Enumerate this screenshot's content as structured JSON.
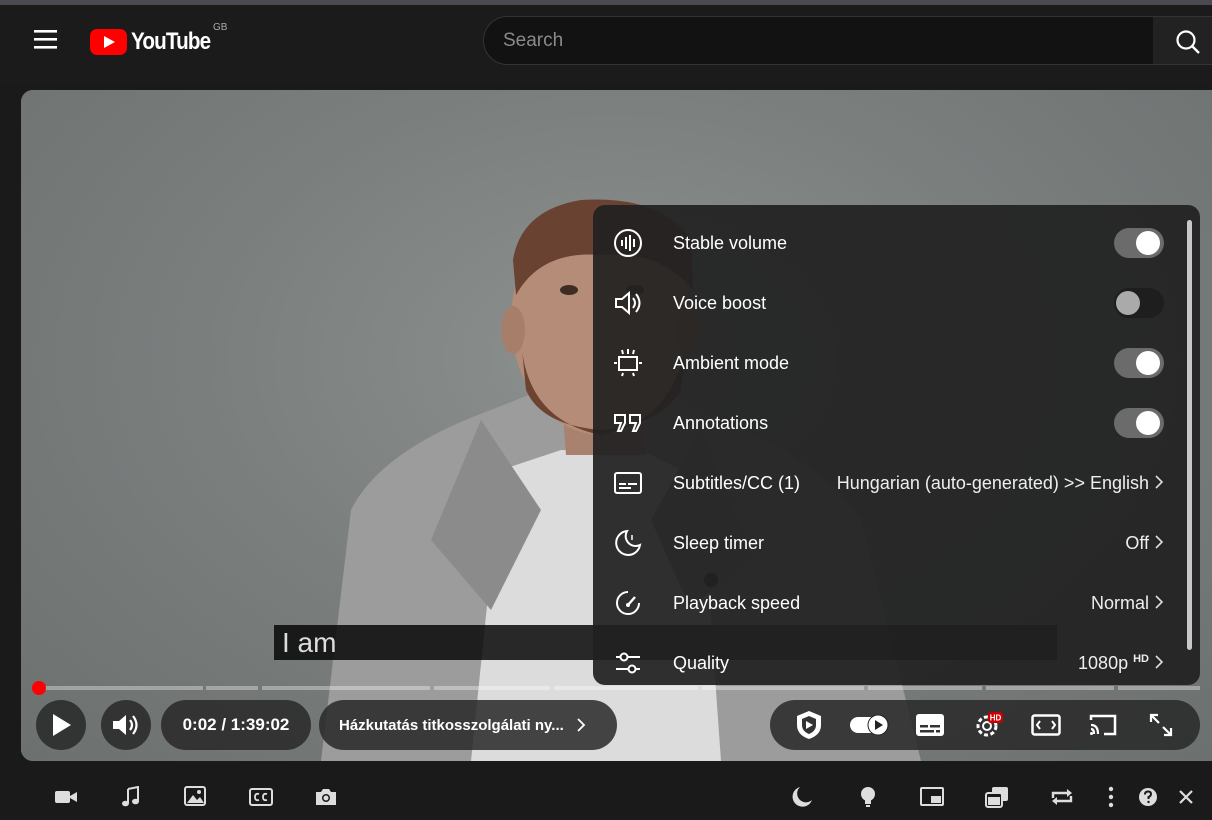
{
  "masthead": {
    "logo_text": "YouTube",
    "country_code": "GB",
    "search_placeholder": "Search"
  },
  "video": {
    "caption_text": "I am",
    "time_display": "0:02 / 1:39:02",
    "chapter_title": "Házkutatás titkosszolgálati ny...",
    "progress_fraction": 0.0003
  },
  "settings": {
    "items": [
      {
        "label": "Stable volume",
        "type": "toggle",
        "state": "on",
        "icon": "stable-volume-icon"
      },
      {
        "label": "Voice boost",
        "type": "toggle",
        "state": "off",
        "icon": "voice-boost-icon"
      },
      {
        "label": "Ambient mode",
        "type": "toggle",
        "state": "on",
        "icon": "ambient-mode-icon"
      },
      {
        "label": "Annotations",
        "type": "toggle",
        "state": "on",
        "icon": "annotations-icon"
      },
      {
        "label": "Subtitles/CC (1)",
        "type": "menu",
        "value": "Hungarian (auto-generated) >> English",
        "icon": "subtitles-icon"
      },
      {
        "label": "Sleep timer",
        "type": "menu",
        "value": "Off",
        "icon": "sleep-timer-icon"
      },
      {
        "label": "Playback speed",
        "type": "menu",
        "value": "Normal",
        "icon": "playback-speed-icon"
      },
      {
        "label": "Quality",
        "type": "menu",
        "value": "1080p",
        "value_sup": "HD",
        "icon": "quality-icon"
      }
    ]
  },
  "controls": {
    "settings_badge": "HD"
  },
  "colors": {
    "brand_red": "#ff0000",
    "panel_bg": "#212121",
    "toggle_on": "#6b6b6b"
  }
}
